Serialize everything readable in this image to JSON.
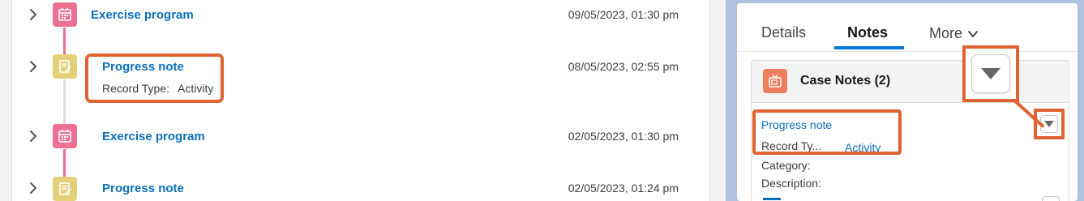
{
  "timeline": {
    "items": [
      {
        "title": "Exercise program",
        "date": "09/05/2023, 01:30 pm",
        "icon": "calendar-icon",
        "color": "#eb7092"
      },
      {
        "title": "Progress note",
        "record_type_label": "Record Type:",
        "record_type_value": "Activity",
        "date": "08/05/2023, 02:55 pm",
        "icon": "note-icon",
        "color": "#e3d079"
      },
      {
        "title": "Exercise program",
        "date": "02/05/2023, 01:30 pm",
        "icon": "calendar-icon",
        "color": "#eb7092"
      },
      {
        "title": "Progress note",
        "date": "02/05/2023, 01:24 pm",
        "icon": "note-icon",
        "color": "#e3d079"
      }
    ]
  },
  "tabs": {
    "details": "Details",
    "notes": "Notes",
    "more": "More"
  },
  "card": {
    "title": "Case Notes (2)",
    "icon": "tv-icon",
    "note_link": "Progress note",
    "record_type_label": "Record Ty...",
    "record_type_value": "Activity",
    "category_label": "Category:",
    "description_label": "Description:"
  },
  "colors": {
    "accent": "#0176d3",
    "link": "#0b6fb8",
    "highlight": "#e06331",
    "panel_bg": "#b0c1df"
  }
}
